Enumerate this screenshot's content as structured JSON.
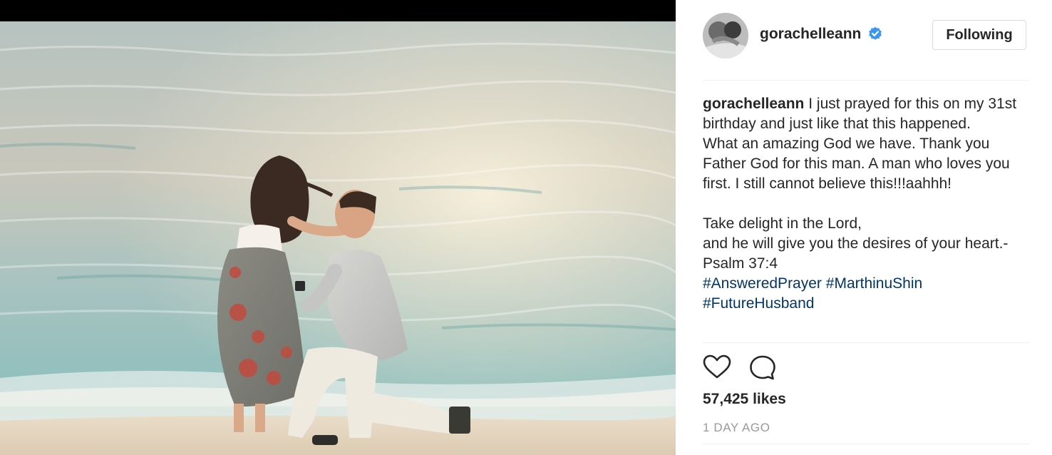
{
  "post": {
    "username": "gorachelleann",
    "verified": true,
    "follow_label": "Following",
    "caption": {
      "username": "gorachelleann",
      "line1": "I just prayed for this on my 31st birthday and just like that this happened.",
      "line2": "What an amazing God we have. Thank you Father God for this man. A man who loves you first. I still cannot believe this!!!aahhh!",
      "line3": "Take delight in the Lord,",
      "line4": "and he will give you the desires of your heart.-Psalm 37:4",
      "hashtags": [
        "#AnsweredPrayer",
        "#MarthinuShin",
        "#FutureHusband"
      ]
    },
    "likes": "57,425 likes",
    "time_ago": "1 DAY AGO"
  },
  "icons": {
    "verified": "verified-badge-icon",
    "like": "heart-outline-icon",
    "comment": "comment-bubble-icon"
  },
  "colors": {
    "accent_blue": "#3897f0",
    "hashtag": "#003569",
    "text": "#262626",
    "muted": "#999999",
    "border": "#dbdbdb"
  }
}
